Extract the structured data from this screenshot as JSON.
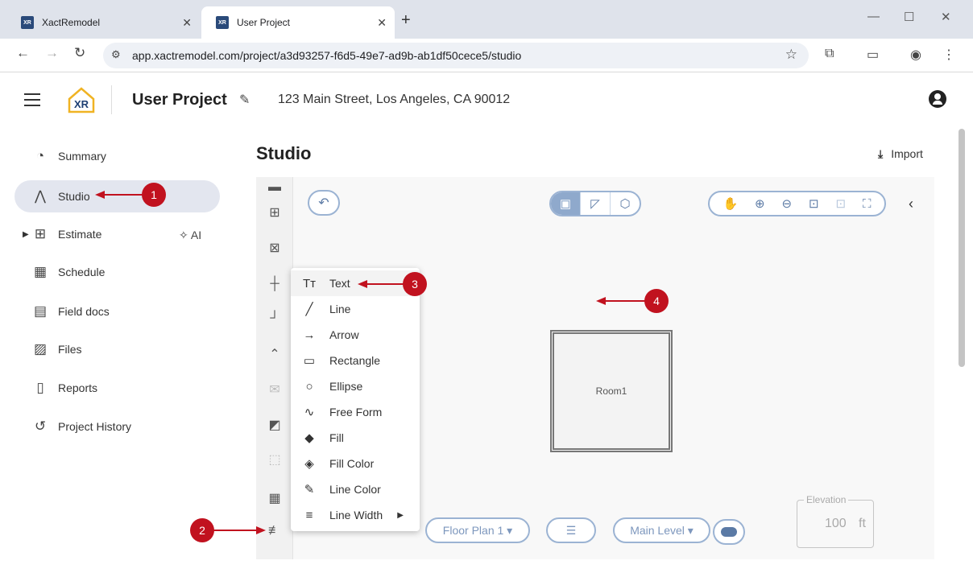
{
  "browser": {
    "tabs": [
      {
        "label": "XactRemodel",
        "favicon": "XR"
      },
      {
        "label": "User Project",
        "favicon": "XR"
      }
    ],
    "url": "app.xactremodel.com/project/a3d93257-f6d5-49e7-ad9b-ab1df50cece5/studio"
  },
  "header": {
    "logo_text": "XR",
    "project_title": "User Project",
    "address": "123 Main Street, Los Angeles, CA 90012"
  },
  "sidebar": {
    "items": [
      {
        "label": "Summary",
        "icon": "speedometer-icon"
      },
      {
        "label": "Studio",
        "icon": "compass-icon"
      },
      {
        "label": "Estimate",
        "icon": "calculator-icon"
      },
      {
        "label": "Schedule",
        "icon": "calendar-icon"
      },
      {
        "label": "Field docs",
        "icon": "clipboard-icon"
      },
      {
        "label": "Files",
        "icon": "photo-library-icon"
      },
      {
        "label": "Reports",
        "icon": "document-icon"
      },
      {
        "label": "Project History",
        "icon": "history-icon"
      }
    ],
    "ai_label": "AI"
  },
  "main": {
    "title": "Studio",
    "import_label": "Import"
  },
  "canvas": {
    "room_label": "Room1",
    "floor_plan_label": "Floor Plan 1",
    "level_label": "Main Level",
    "elevation_label": "Elevation",
    "elevation_value": "100",
    "elevation_unit": "ft"
  },
  "menu": {
    "items": [
      {
        "label": "Text",
        "icon": "text-icon"
      },
      {
        "label": "Line",
        "icon": "line-icon"
      },
      {
        "label": "Arrow",
        "icon": "arrow-icon"
      },
      {
        "label": "Rectangle",
        "icon": "rectangle-icon"
      },
      {
        "label": "Ellipse",
        "icon": "ellipse-icon"
      },
      {
        "label": "Free Form",
        "icon": "freeform-icon"
      },
      {
        "label": "Fill",
        "icon": "fill-icon"
      },
      {
        "label": "Fill Color",
        "icon": "fill-color-icon"
      },
      {
        "label": "Line Color",
        "icon": "line-color-icon"
      },
      {
        "label": "Line Width",
        "icon": "line-width-icon"
      }
    ]
  },
  "callouts": [
    "1",
    "2",
    "3",
    "4"
  ],
  "colors": {
    "accent": "#8fa9cc",
    "callout": "#c1121f",
    "active_nav": "#e3e6ef"
  }
}
